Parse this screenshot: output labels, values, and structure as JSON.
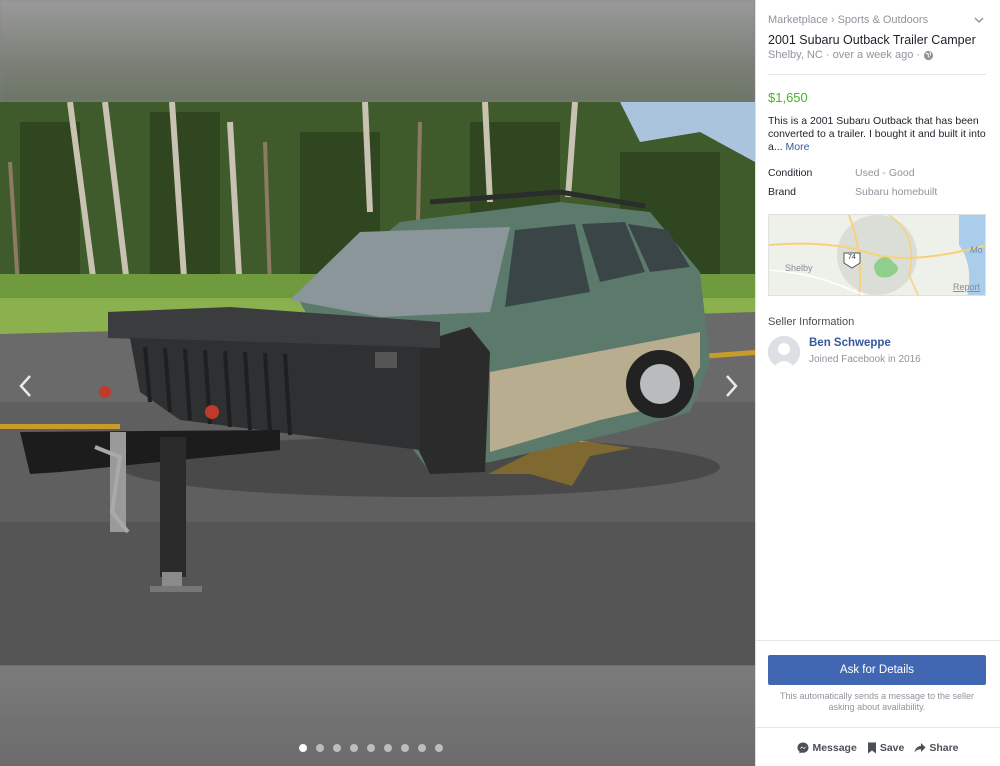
{
  "viewer": {
    "photo_count": 9,
    "active_photo": 1
  },
  "listing": {
    "breadcrumb": [
      "Marketplace",
      "Sports & Outdoors"
    ],
    "breadcrumb_sep": "›",
    "title": "2001 Subaru Outback Trailer Camper",
    "location_time": "Shelby, NC · over a week ago ·",
    "price": "$1,650",
    "description": "This is a 2001 Subaru Outback that has been converted to a trailer. I bought it and built it into a...",
    "more_link": "More",
    "attributes": [
      {
        "key": "Condition",
        "value": "Used - Good"
      },
      {
        "key": "Brand",
        "value": "Subaru homebuilt"
      }
    ],
    "map": {
      "city_label": "Shelby",
      "route_label": "74",
      "edge_label": "Mo",
      "report_label": "Report"
    }
  },
  "seller": {
    "heading": "Seller Information",
    "name": "Ben Schweppe",
    "joined": "Joined Facebook in 2016"
  },
  "contact": {
    "button_label": "Ask for Details",
    "note": "This automatically sends a message to the seller asking about availability."
  },
  "actions": {
    "message": "Message",
    "save": "Save",
    "share": "Share"
  },
  "colors": {
    "price": "#42b72a",
    "link": "#365899",
    "button": "#4267b2"
  }
}
